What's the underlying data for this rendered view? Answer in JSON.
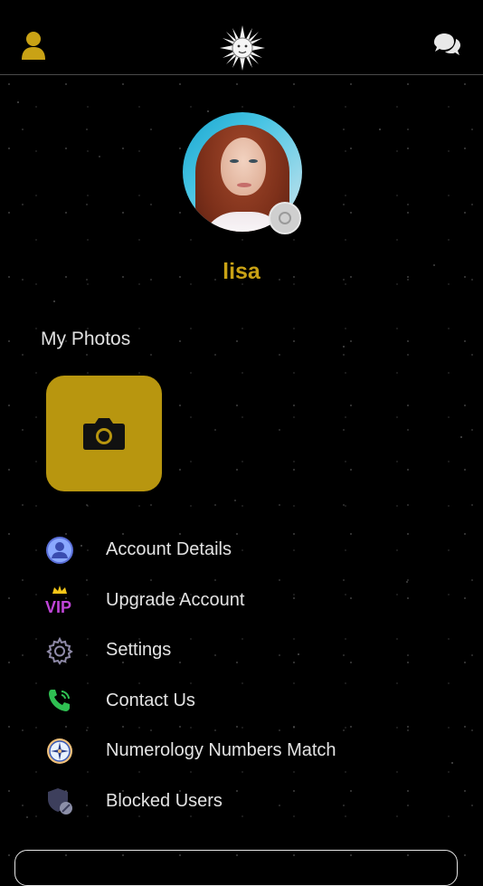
{
  "header": {
    "profile_icon": "person-icon",
    "logo_icon": "sun-face-logo",
    "chat_icon": "chat-bubbles-icon"
  },
  "profile": {
    "username": "lisa",
    "avatar_badge_icon": "camera-badge-icon"
  },
  "photos": {
    "title": "My Photos",
    "add_icon": "camera-icon"
  },
  "menu": {
    "items": [
      {
        "label": "Account Details",
        "icon": "account-icon"
      },
      {
        "label": "Upgrade Account",
        "icon": "vip-crown-icon"
      },
      {
        "label": "Settings",
        "icon": "gear-icon"
      },
      {
        "label": "Contact Us",
        "icon": "phone-icon"
      },
      {
        "label": "Numerology Numbers Match",
        "icon": "compass-icon"
      },
      {
        "label": "Blocked Users",
        "icon": "shield-block-icon"
      }
    ]
  },
  "colors": {
    "accent_gold": "#c9a215",
    "photo_tile": "#b8960f",
    "background": "#000000"
  }
}
